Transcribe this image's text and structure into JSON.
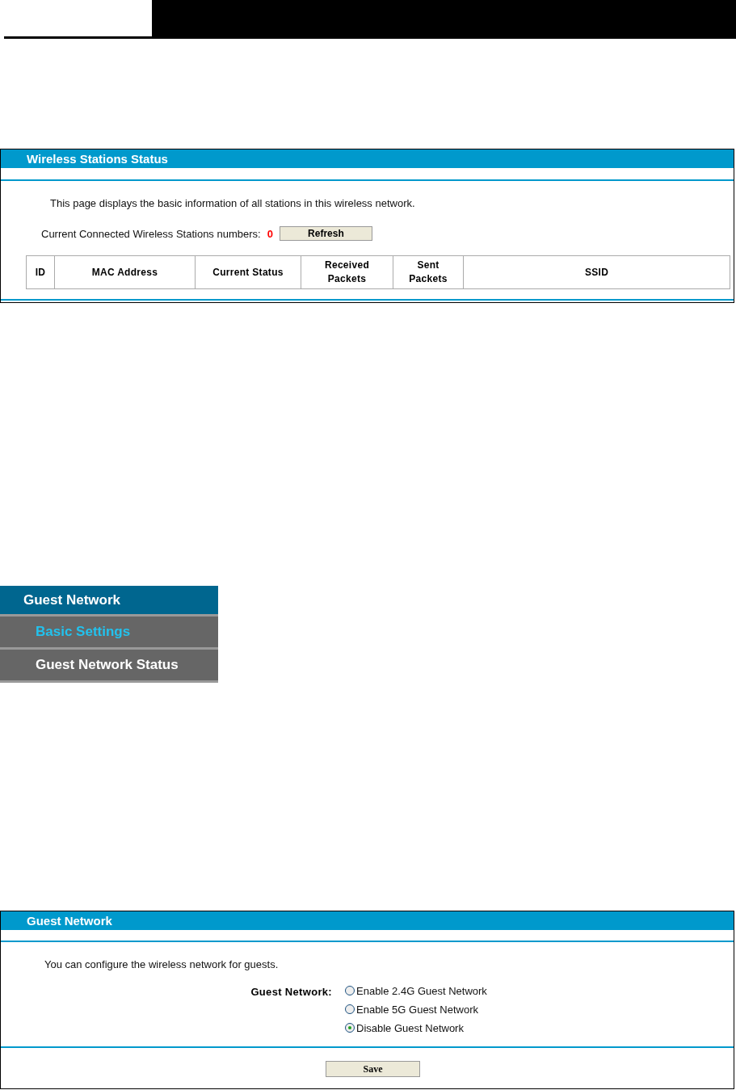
{
  "stations_panel": {
    "title": "Wireless Stations Status",
    "description": "This page displays the basic information of all stations in this wireless network.",
    "count_label": "Current Connected Wireless Stations numbers:",
    "count": "0",
    "refresh_button": "Refresh",
    "columns": [
      "ID",
      "MAC Address",
      "Current Status",
      "Received Packets",
      "Sent Packets",
      "SSID"
    ]
  },
  "menu": {
    "title": "Guest Network",
    "items": [
      {
        "label": "Basic Settings",
        "selected": true
      },
      {
        "label": "Guest Network Status",
        "selected": false
      }
    ]
  },
  "guest_panel": {
    "title": "Guest Network",
    "description": "You can configure the wireless network for guests.",
    "field_label": "Guest Network:",
    "options": [
      {
        "label": "Enable 2.4G Guest Network",
        "selected": false
      },
      {
        "label": "Enable 5G Guest Network",
        "selected": false
      },
      {
        "label": "Disable Guest Network",
        "selected": true
      }
    ],
    "save_button": "Save"
  }
}
